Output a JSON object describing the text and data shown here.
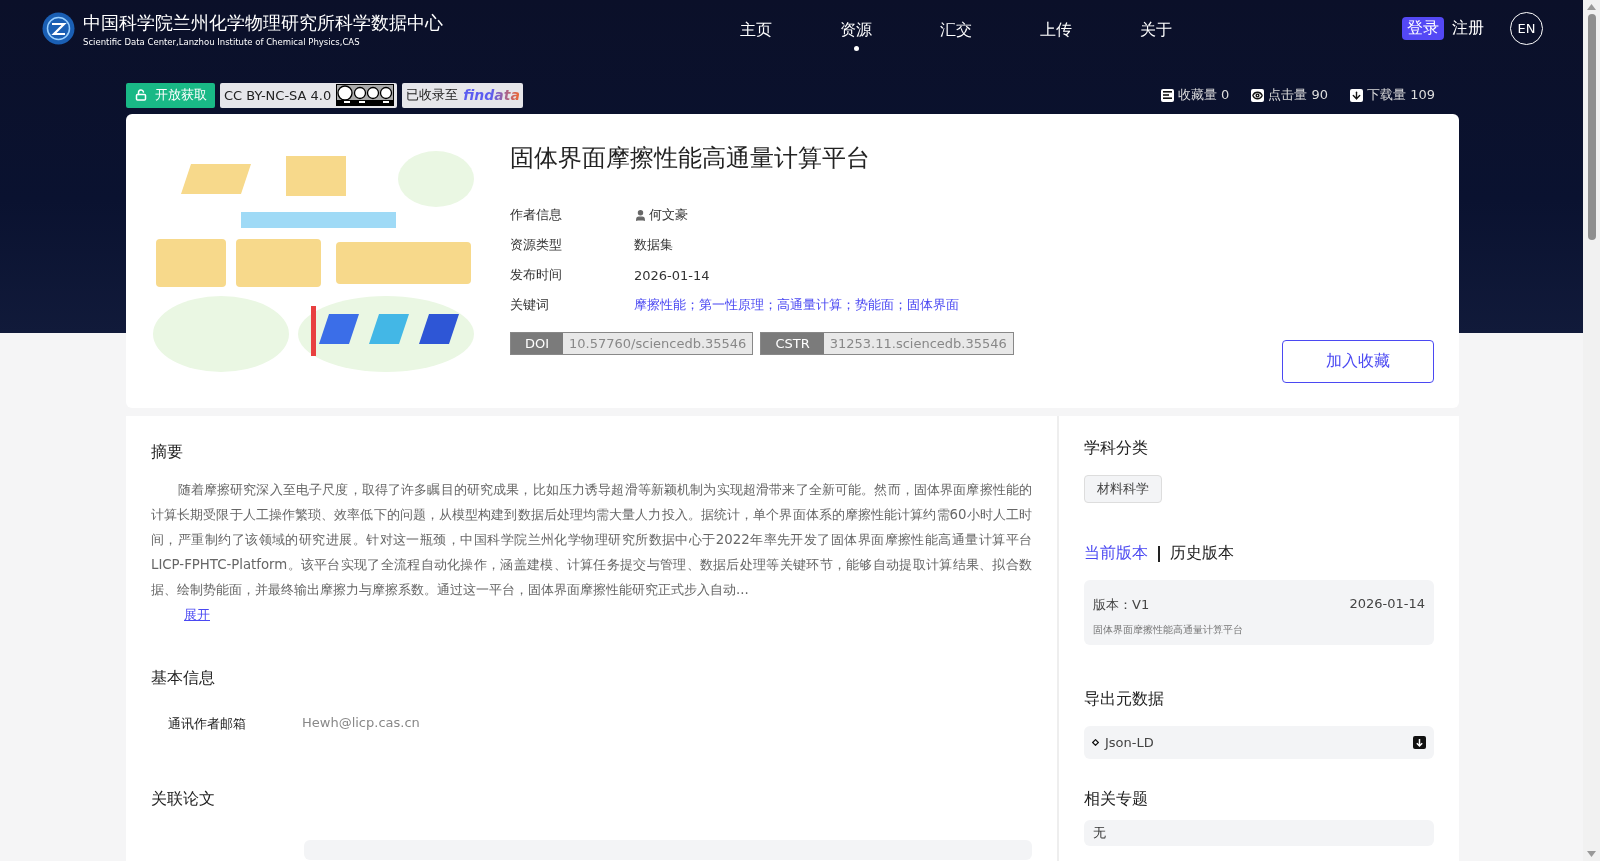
{
  "site": {
    "title": "中国科学院兰州化学物理研究所科学数据中心",
    "subtitle": "Scientific Data Center,Lanzhou Institute of Chemical Physics,CAS"
  },
  "nav": [
    {
      "label": "主页",
      "selected": false
    },
    {
      "label": "资源",
      "selected": true
    },
    {
      "label": "汇交",
      "selected": false
    },
    {
      "label": "上传",
      "selected": false
    },
    {
      "label": "关于",
      "selected": false
    }
  ],
  "auth": {
    "login": "登录",
    "register": "注册",
    "language": "EN"
  },
  "badges": {
    "open_access": "开放获取",
    "license": "CC BY-NC-SA 4.0",
    "indexed": "已收录至",
    "indexed_logo": "findata"
  },
  "stats": [
    {
      "kind": "favorites",
      "label": "收藏量 0"
    },
    {
      "kind": "views",
      "label": "点击量 90"
    },
    {
      "kind": "downloads",
      "label": "下载量 109"
    }
  ],
  "dataset": {
    "title": "固体界面摩擦性能高通量计算平台",
    "fields": [
      {
        "kind": "author",
        "label": "作者信息",
        "value": "何文豪"
      },
      {
        "kind": "text",
        "label": "资源类型",
        "value": "数据集"
      },
      {
        "kind": "text",
        "label": "发布时间",
        "value": "2026-01-14"
      },
      {
        "kind": "keywords",
        "label": "关键词",
        "value": "摩擦性能；第一性原理；高通量计算；势能面；固体界面"
      }
    ],
    "identifiers": [
      {
        "scheme": "DOI",
        "value": "10.57760/sciencedb.35546"
      },
      {
        "scheme": "CSTR",
        "value": "31253.11.sciencedb.35546"
      }
    ],
    "favorite_button": "加入收藏"
  },
  "abstract": {
    "heading": "摘要",
    "text": "随着摩擦研究深入至电子尺度，取得了许多瞩目的研究成果，比如压力诱导超滑等新颖机制为实现超滑带来了全新可能。然而，固体界面摩擦性能的计算长期受限于人工操作繁琐、效率低下的问题，从模型构建到数据后处理均需大量人力投入。据统计，单个界面体系的摩擦性能计算约需60小时人工时间，严重制约了该领域的研究进展。针对这一瓶颈，中国科学院兰州化学物理研究所数据中心于2022年率先开发了固体界面摩擦性能高通量计算平台LICP-FPHTC-Platform。该平台实现了全流程自动化操作，涵盖建模、计算任务提交与管理、数据后处理等关键环节，能够自动提取计算结果、拟合数据、绘制势能面，并最终输出摩擦力与摩擦系数。通过这一平台，固体界面摩擦性能研究正式步入自动...",
    "expand": "展开"
  },
  "basic_info": {
    "heading": "基本信息",
    "rows": [
      {
        "label": "通讯作者邮箱",
        "value": "Hewh@licp.cas.cn"
      }
    ]
  },
  "related_papers": {
    "heading": "关联论文"
  },
  "sidebar": {
    "subject": {
      "heading": "学科分类",
      "tags": [
        "材料科学"
      ]
    },
    "versions": {
      "tabs": [
        {
          "label": "当前版本",
          "selected": true
        },
        {
          "label": "历史版本",
          "selected": false
        }
      ],
      "card": {
        "version": "版本：V1",
        "date": "2026-01-14",
        "title": "固体界面摩擦性能高通量计算平台"
      }
    },
    "export": {
      "heading": "导出元数据",
      "formats": [
        "Json-LD"
      ]
    },
    "topics": {
      "heading": "相关专题",
      "value": "无"
    }
  }
}
